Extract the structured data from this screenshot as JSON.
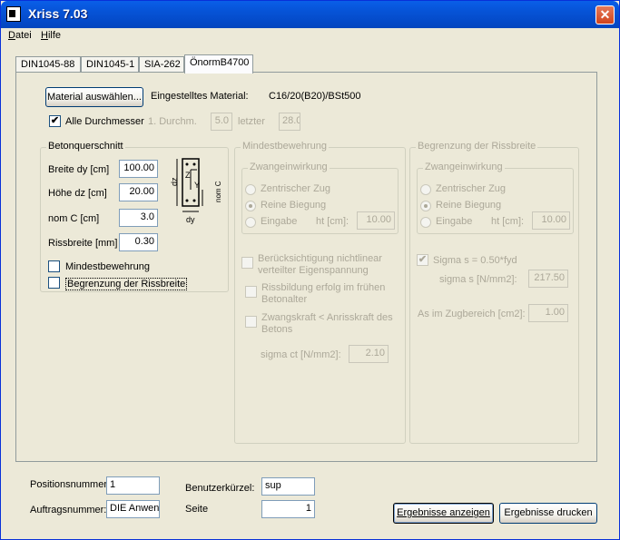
{
  "window": {
    "title": "Xriss 7.03"
  },
  "menu": {
    "datei": "Datei",
    "hilfe": "Hilfe"
  },
  "tabs": [
    "DIN1045-88",
    "DIN1045-1",
    "SIA-262",
    "ÖnormB4700"
  ],
  "material": {
    "button": "Material auswählen...",
    "label": "Eingestelltes Material:",
    "value": "C16/20(B20)/BSt500"
  },
  "durchmesser": {
    "all_label": "Alle Durchmesser",
    "first_label": "1. Durchm.",
    "first_value": "5.0",
    "last_label": "letzter",
    "last_value": "28.0"
  },
  "beton": {
    "legend": "Betonquerschnitt",
    "breite_label": "Breite dy [cm]",
    "breite_value": "100.00",
    "hoehe_label": "Höhe dz [cm]",
    "hoehe_value": "20.00",
    "nomc_label": "nom C [cm]",
    "nomc_value": "3.0",
    "riss_label": "Rissbreite [mm]",
    "riss_value": "0.30",
    "mindest_label": "Mindestbewehrung",
    "begrenzung_label": "Begrenzung der Rissbreite",
    "diagram": {
      "dz": "dz",
      "dy": "dy",
      "z": "Z",
      "y": "Y",
      "nomc": "nom C"
    }
  },
  "mindest": {
    "legend": "Mindestbewehrung",
    "zwang_legend": "Zwangeinwirkung",
    "zentrisch": "Zentrischer Zug",
    "biegung": "Reine Biegung",
    "eingabe": "Eingabe",
    "ht_label": "ht [cm]:",
    "ht_value": "10.00",
    "nichtlinear": "Berücksichtigung nichtlinear verteilter Eigenspannung",
    "frueh": "Rissbildung erfolg im frühen Betonalter",
    "zwangskraft": "Zwangskraft < Anrisskraft des Betons",
    "sigma_ct_label": "sigma ct [N/mm2]:",
    "sigma_ct_value": "2.10"
  },
  "begr": {
    "legend": "Begrenzung der Rissbreite",
    "zwang_legend": "Zwangeinwirkung",
    "zentrisch": "Zentrischer Zug",
    "biegung": "Reine Biegung",
    "eingabe": "Eingabe",
    "ht_label": "ht [cm]:",
    "ht_value": "10.00",
    "sigma_check": "Sigma s = 0.50*fyd",
    "sigma_s_label": "sigma s [N/mm2]:",
    "sigma_s_value": "217.50",
    "as_label": "As im Zugbereich [cm2]:",
    "as_value": "1.00"
  },
  "footer": {
    "pos_label": "Positionsnummer:",
    "pos_value": "1",
    "auftrag_label": "Auftragsnummer:",
    "auftrag_value": "DIE Anwen",
    "benutzer_label": "Benutzerkürzel:",
    "benutzer_value": "sup",
    "seite_label": "Seite",
    "seite_value": "1",
    "anzeigen": "Ergebnisse anzeigen",
    "drucken": "Ergebnisse drucken"
  }
}
